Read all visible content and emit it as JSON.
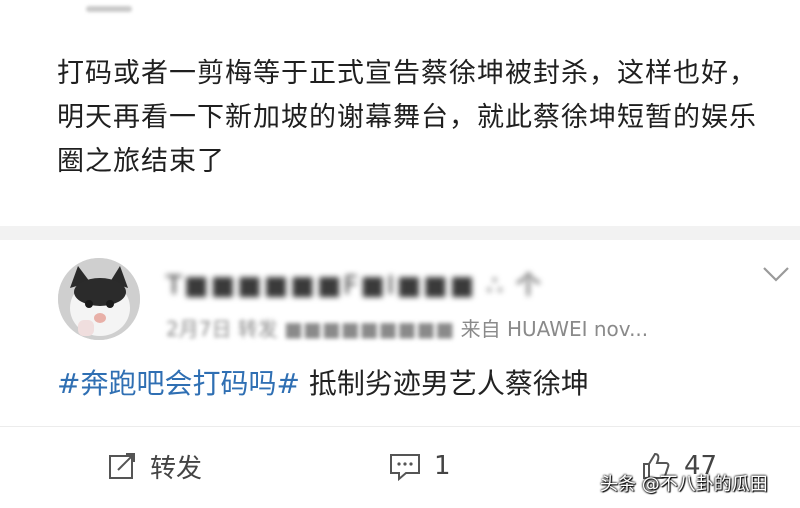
{
  "post": {
    "text": "打码或者一剪梅等于正式宣告蔡徐坤被封杀，这样也好，明天再看一下新加坡的谢幕舞台，就此蔡徐坤短暂的娱乐圈之旅结束了"
  },
  "repost": {
    "username": "T■■■■■■F■I■■■ ∴  个",
    "meta_blurred": "2月7日  转发  ■■■■■■■■■",
    "source": "来自 HUAWEI nov...",
    "hashtag": "#奔跑吧会打码吗#",
    "text": " 抵制劣迹男艺人蔡徐坤"
  },
  "actions": {
    "repost_label": "转发",
    "comment_count": "1",
    "like_count": "47"
  },
  "watermark": "头条 @不八卦的瓜田",
  "icons": [
    "share-edit-icon",
    "comment-icon",
    "like-icon",
    "chevron-down-icon",
    "avatar-cat"
  ],
  "colors": {
    "hashtag": "#2f6fb3",
    "text": "#1f1f1f",
    "meta": "#8a8a8a"
  }
}
